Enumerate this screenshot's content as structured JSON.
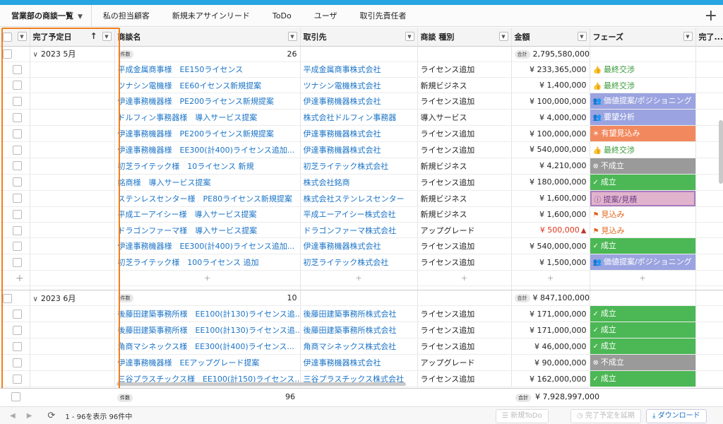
{
  "tabs": [
    {
      "label": "営業部の商談一覧",
      "active": true
    },
    {
      "label": "私の担当顧客"
    },
    {
      "label": "新規未アサインリード"
    },
    {
      "label": "ToDo"
    },
    {
      "label": "ユーザ"
    },
    {
      "label": "取引先責任者"
    }
  ],
  "add_tab": "+",
  "columns": {
    "due": "完了予定日",
    "deal": "商談名",
    "account": "取引先",
    "type": "商談 種別",
    "amount": "金額",
    "phase": "フェーズ",
    "completed": "完了..."
  },
  "groups": [
    {
      "label": "2023 5月",
      "count_label": "件数",
      "count": "26",
      "sum_label": "合計",
      "sum": "2,795,580,000",
      "rows": [
        {
          "deal": "平成金属商事様　EE150ライセンス",
          "account": "平成金属商事株式会社",
          "type": "ライセンス追加",
          "amount": "¥ 233,365,000",
          "phase": "最終交渉",
          "style": "green-text",
          "icon": "thumbs-up-icon"
        },
        {
          "deal": "ツナシン電機様　EE60イセンス新規提案",
          "account": "ツナシン電機株式会社",
          "type": "新規ビジネス",
          "amount": "¥ 1,400,000",
          "phase": "最終交渉",
          "style": "green-text",
          "icon": "thumbs-up-icon"
        },
        {
          "deal": "伊達事務機器様　PE200ライセンス新規提案",
          "account": "伊達事務機器株式会社",
          "type": "ライセンス追加",
          "amount": "¥ 100,000,000",
          "phase": "価値提案/ポジショニング",
          "style": "purple",
          "icon": "people-icon"
        },
        {
          "deal": "ドルフィン事務器様　導入サービス提案",
          "account": "株式会社ドルフィン事務器",
          "type": "導入サービス",
          "amount": "¥ 4,000,000",
          "phase": "要望分析",
          "style": "purple",
          "icon": "people-icon"
        },
        {
          "deal": "伊達事務機器様　PE200ライセンス新規提案",
          "account": "伊達事務機器株式会社",
          "type": "ライセンス追加",
          "amount": "¥ 100,000,000",
          "phase": "有望見込み",
          "style": "orange",
          "icon": "sun-icon"
        },
        {
          "deal": "伊達事務機器様　EE300(計400)ライセンス追加...",
          "account": "伊達事務機器株式会社",
          "type": "ライセンス追加",
          "amount": "¥ 540,000,000",
          "phase": "最終交渉",
          "style": "green-text",
          "icon": "thumbs-up-icon"
        },
        {
          "deal": "初芝ライテック様　10ライセンス 新規",
          "account": "初芝ライテック株式会社",
          "type": "新規ビジネス",
          "amount": "¥ 4,210,000",
          "phase": "不成立",
          "style": "gray",
          "icon": "x-circle-icon"
        },
        {
          "deal": "銘商様　導入サービス提案",
          "account": "株式会社銘商",
          "type": "ライセンス追加",
          "amount": "¥ 180,000,000",
          "phase": "成立",
          "style": "green-bg",
          "icon": "check-icon"
        },
        {
          "deal": "ステンレスセンター様　PE80ライセンス新規提案",
          "account": "株式会社ステンレスセンター",
          "type": "新規ビジネス",
          "amount": "¥ 1,600,000",
          "phase": "提案/見積",
          "style": "pink",
          "icon": "info-icon"
        },
        {
          "deal": "平成エーアイシー様　導入サービス提案",
          "account": "平成エーアイシー株式会社",
          "type": "新規ビジネス",
          "amount": "¥ 1,600,000",
          "phase": "見込み",
          "style": "red-text",
          "icon": "flag-icon"
        },
        {
          "deal": "ドラゴンファーマ様　導入サービス提案",
          "account": "ドラゴンファーマ株式会社",
          "type": "アップグレード",
          "amount": "¥ 500,000",
          "amount_red": true,
          "phase": "見込み",
          "style": "red-text",
          "icon": "flag-icon"
        },
        {
          "deal": "伊達事務機器様　EE300(計400)ライセンス追加...",
          "account": "伊達事務機器株式会社",
          "type": "ライセンス追加",
          "amount": "¥ 540,000,000",
          "phase": "成立",
          "style": "green-bg",
          "icon": "check-icon"
        },
        {
          "deal": "初芝ライテック様　100ライセンス 追加",
          "account": "初芝ライテック株式会社",
          "type": "ライセンス追加",
          "amount": "¥ 1,500,000",
          "phase": "価値提案/ポジショニング",
          "style": "purple",
          "icon": "people-icon"
        }
      ]
    },
    {
      "label": "2023 6月",
      "count_label": "件数",
      "count": "10",
      "sum_label": "合計",
      "sum": "¥ 847,100,000",
      "rows": [
        {
          "deal": "後藤田建築事務所様　EE100(計130)ライセンス追...",
          "account": "後藤田建築事務所株式会社",
          "type": "ライセンス追加",
          "amount": "¥ 171,000,000",
          "phase": "成立",
          "style": "green-bg",
          "icon": "check-icon"
        },
        {
          "deal": "後藤田建築事務所様　EE100(計130)ライセンス追...",
          "account": "後藤田建築事務所株式会社",
          "type": "ライセンス追加",
          "amount": "¥ 171,000,000",
          "phase": "成立",
          "style": "green-bg",
          "icon": "check-icon"
        },
        {
          "deal": "角商マシネックス様　EE300(計400)ライセンス...",
          "account": "角商マシネックス株式会社",
          "type": "ライセンス追加",
          "amount": "¥ 46,000,000",
          "phase": "成立",
          "style": "green-bg",
          "icon": "check-icon"
        },
        {
          "deal": "伊達事務機器様　EEアップグレード提案",
          "account": "伊達事務機器株式会社",
          "type": "アップグレード",
          "amount": "¥ 90,000,000",
          "phase": "不成立",
          "style": "gray",
          "icon": "x-circle-icon"
        },
        {
          "deal": "三谷プラスチックス様　EE100(計150)ライセンス...",
          "account": "三谷プラスチックス株式会社",
          "type": "ライセンス追加",
          "amount": "¥ 162,000,000",
          "phase": "成立",
          "style": "green-bg",
          "icon": "check-icon"
        }
      ]
    }
  ],
  "summary": {
    "count_label": "件数",
    "count": "96",
    "sum_label": "合計",
    "sum": "7,928,997,000"
  },
  "footer": {
    "status": "1 - 96を表示 96件中",
    "new_todo": "新規ToDo",
    "extend": "完了予定を延期",
    "download": "ダウンロード"
  },
  "colors": {
    "accent": "#27a5e0",
    "highlight": "#f07f1b"
  }
}
